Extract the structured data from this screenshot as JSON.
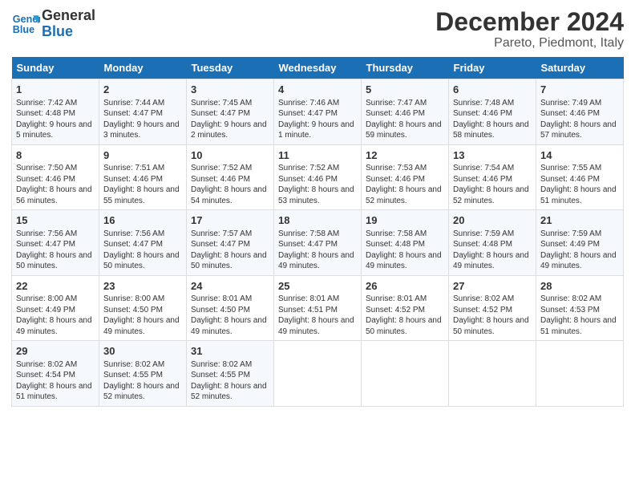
{
  "logo": {
    "line1": "General",
    "line2": "Blue"
  },
  "title": "December 2024",
  "subtitle": "Pareto, Piedmont, Italy",
  "days_of_week": [
    "Sunday",
    "Monday",
    "Tuesday",
    "Wednesday",
    "Thursday",
    "Friday",
    "Saturday"
  ],
  "weeks": [
    [
      {
        "day": "1",
        "rise": "Sunrise: 7:42 AM",
        "set": "Sunset: 4:48 PM",
        "daylight": "Daylight: 9 hours and 5 minutes."
      },
      {
        "day": "2",
        "rise": "Sunrise: 7:44 AM",
        "set": "Sunset: 4:47 PM",
        "daylight": "Daylight: 9 hours and 3 minutes."
      },
      {
        "day": "3",
        "rise": "Sunrise: 7:45 AM",
        "set": "Sunset: 4:47 PM",
        "daylight": "Daylight: 9 hours and 2 minutes."
      },
      {
        "day": "4",
        "rise": "Sunrise: 7:46 AM",
        "set": "Sunset: 4:47 PM",
        "daylight": "Daylight: 9 hours and 1 minute."
      },
      {
        "day": "5",
        "rise": "Sunrise: 7:47 AM",
        "set": "Sunset: 4:46 PM",
        "daylight": "Daylight: 8 hours and 59 minutes."
      },
      {
        "day": "6",
        "rise": "Sunrise: 7:48 AM",
        "set": "Sunset: 4:46 PM",
        "daylight": "Daylight: 8 hours and 58 minutes."
      },
      {
        "day": "7",
        "rise": "Sunrise: 7:49 AM",
        "set": "Sunset: 4:46 PM",
        "daylight": "Daylight: 8 hours and 57 minutes."
      }
    ],
    [
      {
        "day": "8",
        "rise": "Sunrise: 7:50 AM",
        "set": "Sunset: 4:46 PM",
        "daylight": "Daylight: 8 hours and 56 minutes."
      },
      {
        "day": "9",
        "rise": "Sunrise: 7:51 AM",
        "set": "Sunset: 4:46 PM",
        "daylight": "Daylight: 8 hours and 55 minutes."
      },
      {
        "day": "10",
        "rise": "Sunrise: 7:52 AM",
        "set": "Sunset: 4:46 PM",
        "daylight": "Daylight: 8 hours and 54 minutes."
      },
      {
        "day": "11",
        "rise": "Sunrise: 7:52 AM",
        "set": "Sunset: 4:46 PM",
        "daylight": "Daylight: 8 hours and 53 minutes."
      },
      {
        "day": "12",
        "rise": "Sunrise: 7:53 AM",
        "set": "Sunset: 4:46 PM",
        "daylight": "Daylight: 8 hours and 52 minutes."
      },
      {
        "day": "13",
        "rise": "Sunrise: 7:54 AM",
        "set": "Sunset: 4:46 PM",
        "daylight": "Daylight: 8 hours and 52 minutes."
      },
      {
        "day": "14",
        "rise": "Sunrise: 7:55 AM",
        "set": "Sunset: 4:46 PM",
        "daylight": "Daylight: 8 hours and 51 minutes."
      }
    ],
    [
      {
        "day": "15",
        "rise": "Sunrise: 7:56 AM",
        "set": "Sunset: 4:47 PM",
        "daylight": "Daylight: 8 hours and 50 minutes."
      },
      {
        "day": "16",
        "rise": "Sunrise: 7:56 AM",
        "set": "Sunset: 4:47 PM",
        "daylight": "Daylight: 8 hours and 50 minutes."
      },
      {
        "day": "17",
        "rise": "Sunrise: 7:57 AM",
        "set": "Sunset: 4:47 PM",
        "daylight": "Daylight: 8 hours and 50 minutes."
      },
      {
        "day": "18",
        "rise": "Sunrise: 7:58 AM",
        "set": "Sunset: 4:47 PM",
        "daylight": "Daylight: 8 hours and 49 minutes."
      },
      {
        "day": "19",
        "rise": "Sunrise: 7:58 AM",
        "set": "Sunset: 4:48 PM",
        "daylight": "Daylight: 8 hours and 49 minutes."
      },
      {
        "day": "20",
        "rise": "Sunrise: 7:59 AM",
        "set": "Sunset: 4:48 PM",
        "daylight": "Daylight: 8 hours and 49 minutes."
      },
      {
        "day": "21",
        "rise": "Sunrise: 7:59 AM",
        "set": "Sunset: 4:49 PM",
        "daylight": "Daylight: 8 hours and 49 minutes."
      }
    ],
    [
      {
        "day": "22",
        "rise": "Sunrise: 8:00 AM",
        "set": "Sunset: 4:49 PM",
        "daylight": "Daylight: 8 hours and 49 minutes."
      },
      {
        "day": "23",
        "rise": "Sunrise: 8:00 AM",
        "set": "Sunset: 4:50 PM",
        "daylight": "Daylight: 8 hours and 49 minutes."
      },
      {
        "day": "24",
        "rise": "Sunrise: 8:01 AM",
        "set": "Sunset: 4:50 PM",
        "daylight": "Daylight: 8 hours and 49 minutes."
      },
      {
        "day": "25",
        "rise": "Sunrise: 8:01 AM",
        "set": "Sunset: 4:51 PM",
        "daylight": "Daylight: 8 hours and 49 minutes."
      },
      {
        "day": "26",
        "rise": "Sunrise: 8:01 AM",
        "set": "Sunset: 4:52 PM",
        "daylight": "Daylight: 8 hours and 50 minutes."
      },
      {
        "day": "27",
        "rise": "Sunrise: 8:02 AM",
        "set": "Sunset: 4:52 PM",
        "daylight": "Daylight: 8 hours and 50 minutes."
      },
      {
        "day": "28",
        "rise": "Sunrise: 8:02 AM",
        "set": "Sunset: 4:53 PM",
        "daylight": "Daylight: 8 hours and 51 minutes."
      }
    ],
    [
      {
        "day": "29",
        "rise": "Sunrise: 8:02 AM",
        "set": "Sunset: 4:54 PM",
        "daylight": "Daylight: 8 hours and 51 minutes."
      },
      {
        "day": "30",
        "rise": "Sunrise: 8:02 AM",
        "set": "Sunset: 4:55 PM",
        "daylight": "Daylight: 8 hours and 52 minutes."
      },
      {
        "day": "31",
        "rise": "Sunrise: 8:02 AM",
        "set": "Sunset: 4:55 PM",
        "daylight": "Daylight: 8 hours and 52 minutes."
      },
      null,
      null,
      null,
      null
    ]
  ]
}
